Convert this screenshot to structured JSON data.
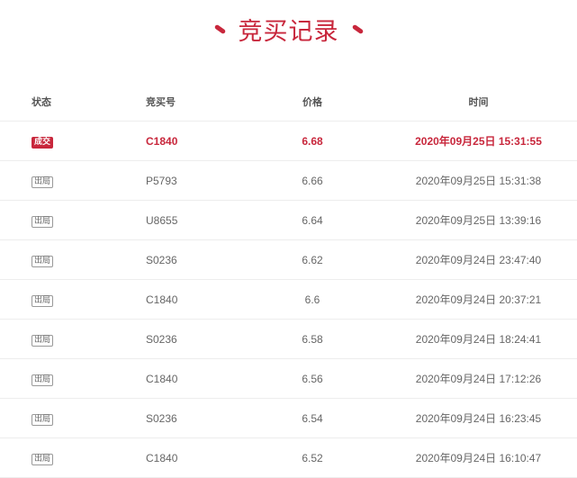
{
  "title": "竞买记录",
  "colors": {
    "accent": "#c8273c",
    "text": "#666666",
    "divider": "#ededed"
  },
  "columns": {
    "status": "状态",
    "code": "竞买号",
    "price": "价格",
    "time": "时间"
  },
  "rows": [
    {
      "status": "成交",
      "code": "C1840",
      "price": "6.68",
      "time": "2020年09月25日 15:31:55"
    },
    {
      "status": "出局",
      "code": "P5793",
      "price": "6.66",
      "time": "2020年09月25日 15:31:38"
    },
    {
      "status": "出局",
      "code": "U8655",
      "price": "6.64",
      "time": "2020年09月25日 13:39:16"
    },
    {
      "status": "出局",
      "code": "S0236",
      "price": "6.62",
      "time": "2020年09月24日 23:47:40"
    },
    {
      "status": "出局",
      "code": "C1840",
      "price": "6.6",
      "time": "2020年09月24日 20:37:21"
    },
    {
      "status": "出局",
      "code": "S0236",
      "price": "6.58",
      "time": "2020年09月24日 18:24:41"
    },
    {
      "status": "出局",
      "code": "C1840",
      "price": "6.56",
      "time": "2020年09月24日 17:12:26"
    },
    {
      "status": "出局",
      "code": "S0236",
      "price": "6.54",
      "time": "2020年09月24日 16:23:45"
    },
    {
      "status": "出局",
      "code": "C1840",
      "price": "6.52",
      "time": "2020年09月24日 16:10:47"
    }
  ]
}
